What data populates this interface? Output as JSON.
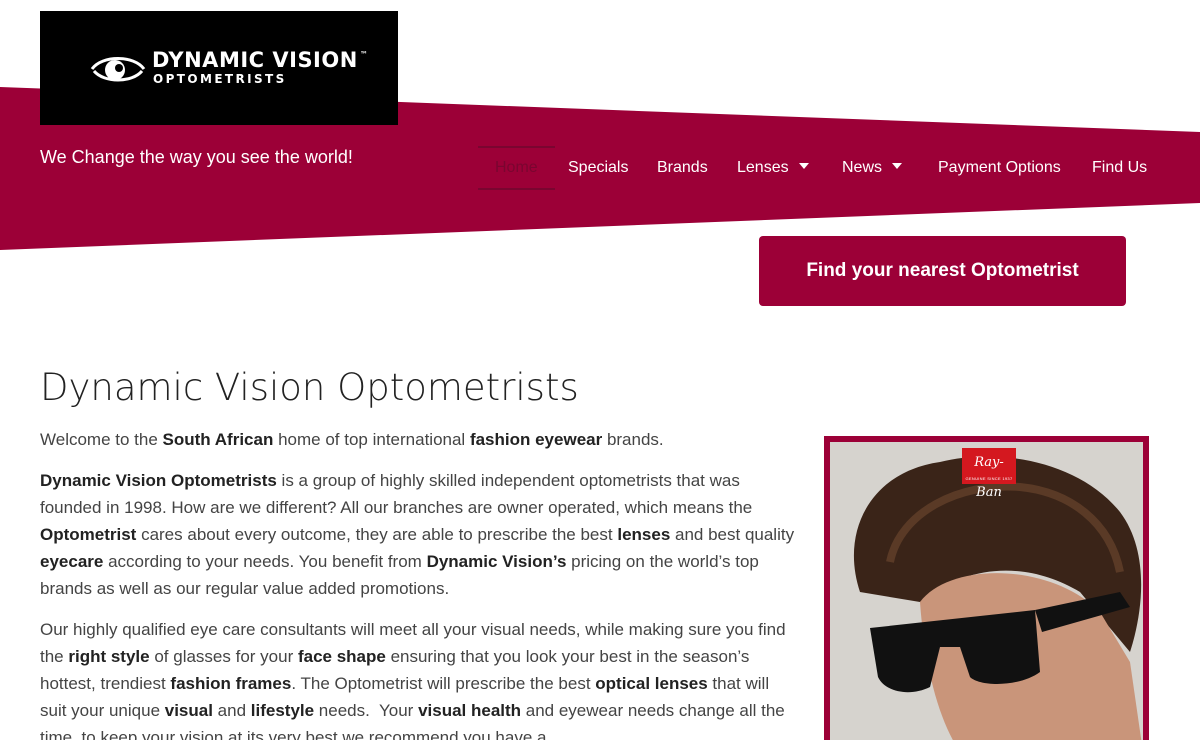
{
  "brand": {
    "name_line1": "DYNAMIC VISION",
    "trademark": "™",
    "name_line2": "OPTOMETRISTS",
    "tagline": "We Change the way you see the world!",
    "accent_color": "#9c0037"
  },
  "nav": {
    "items": [
      {
        "label": "Home",
        "active": true
      },
      {
        "label": "Specials"
      },
      {
        "label": "Brands"
      },
      {
        "label": "Lenses",
        "dropdown": true
      },
      {
        "label": "News",
        "dropdown": true
      },
      {
        "label": "Payment Options"
      },
      {
        "label": "Find Us"
      }
    ]
  },
  "cta": {
    "label": "Find your nearest Optometrist"
  },
  "main": {
    "title": "Dynamic Vision Optometrists",
    "image": {
      "logo_text": "Ray-Ban",
      "logo_subtext": "GENUINE SINCE 1937"
    }
  }
}
